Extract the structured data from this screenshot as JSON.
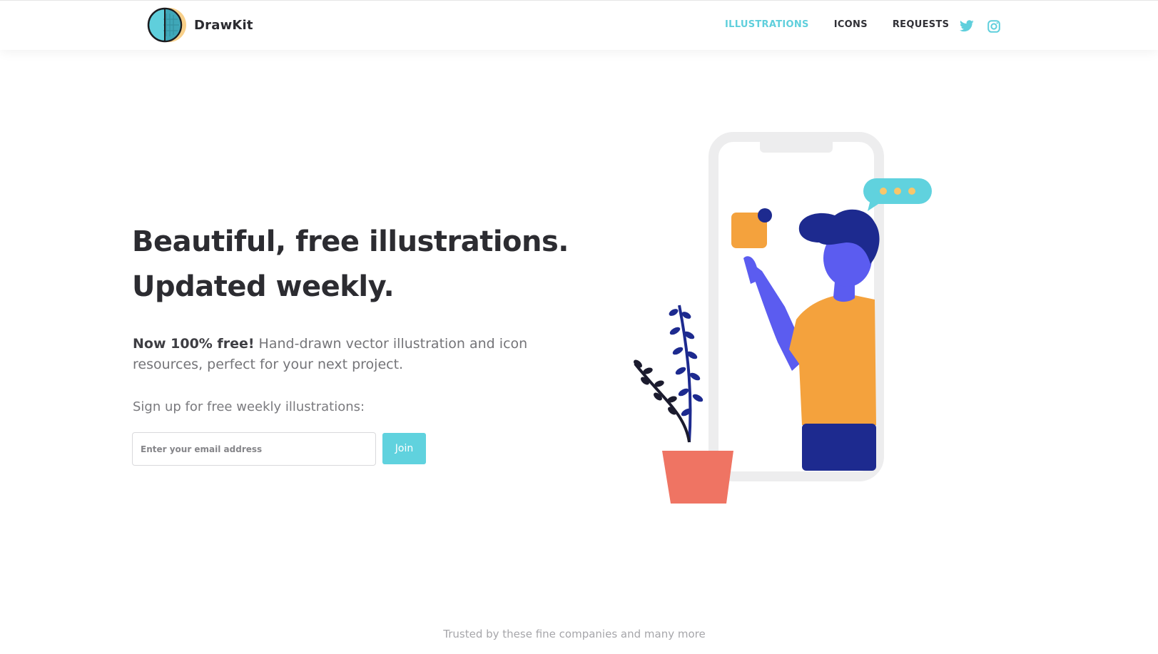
{
  "header": {
    "brand": "DrawKit",
    "nav": [
      {
        "label": "ILLUSTRATIONS",
        "active": true
      },
      {
        "label": "ICONS",
        "active": false
      },
      {
        "label": "REQUESTS",
        "active": false
      }
    ],
    "social": [
      "twitter-icon",
      "instagram-icon"
    ]
  },
  "hero": {
    "headline_line1": "Beautiful, free illustrations.",
    "headline_line2": "Updated weekly.",
    "lead_strong": "Now 100% free!",
    "lead_rest": " Hand-drawn vector illustration and icon resources, perfect for your next project.",
    "signup_label": "Sign up for free weekly illustrations:",
    "email_placeholder": "Enter your email address",
    "join_label": "Join"
  },
  "footer": {
    "trusted_text": "Trusted by these fine companies and many more"
  },
  "colors": {
    "accent": "#5fcfdc",
    "text_dark": "#2c2c31",
    "text_muted": "#747478",
    "illustration_orange": "#f4a23d",
    "illustration_navy": "#1d2a8f",
    "illustration_purple": "#5b5cf0",
    "pot": "#ef7463"
  }
}
